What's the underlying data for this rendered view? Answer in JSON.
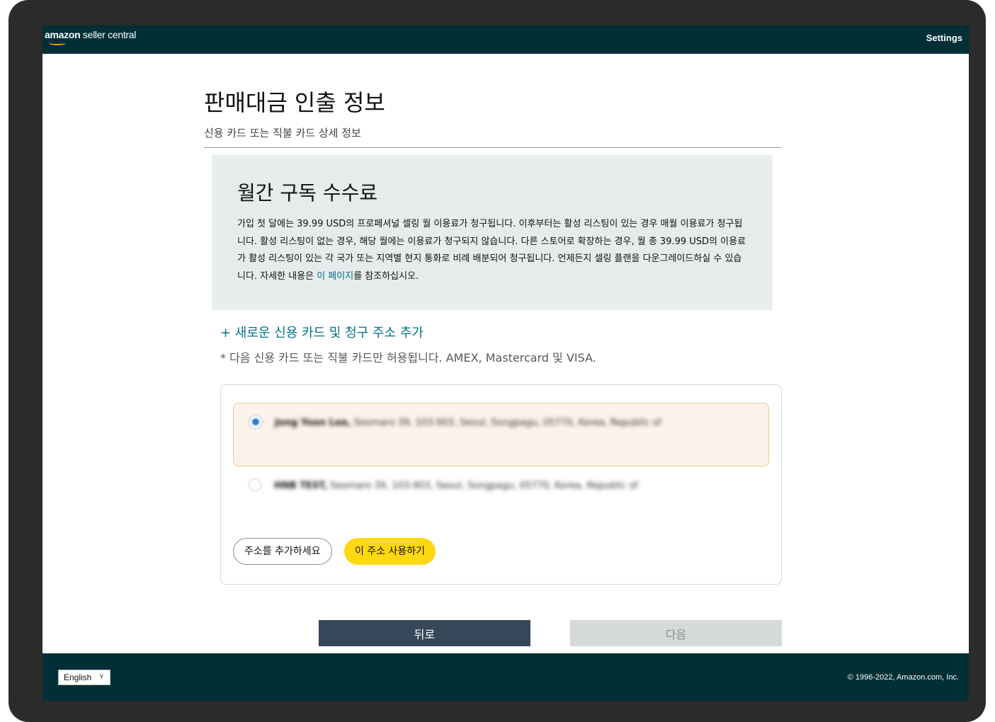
{
  "header": {
    "logo_brand": "amazon",
    "logo_product": "seller central",
    "settings_label": "Settings"
  },
  "page": {
    "title": "판매대금 인출 정보",
    "subtitle": "신용 카드 또는 직불 카드 상세 정보"
  },
  "fee_box": {
    "title": "월간 구독 수수료",
    "body_before_link": "가입 첫 달에는 39.99 USD의 프로페셔널 셀링 월 이용료가 청구됩니다. 이후부터는 활성 리스팅이 있는 경우 매월 이용료가 청구됩니다. 활성 리스팅이 없는 경우, 해당 월에는 이용료가 청구되지 않습니다. 다른 스토어로 확장하는 경우, 월 총 39.99 USD의 이용료가 활성 리스팅이 있는 각 국가 또는 지역별 현지 통화로 비례 배분되어 청구됩니다. 언제든지 셀링 플랜을 다운그레이드하실 수 있습니다. 자세한 내용은 ",
    "link_text": "이 페이지",
    "body_after_link": "를 참조하십시오."
  },
  "card": {
    "add_link": "+ 새로운 신용 카드 및 청구 주소 추가",
    "note": "* 다음 신용 카드 또는 직불 카드만 허용됩니다. AMEX, Mastercard 및 VISA."
  },
  "addresses": [
    {
      "name": "Jong Yoon Lee,",
      "detail": "Seomaro 39, 103-903, Seoul, Songpagu, 05770, Korea, Republic of",
      "selected": true
    },
    {
      "name": "HNB TEST,",
      "detail": "Seomaro 39, 103-903, Seoul, Songpagu, 05770, Korea, Republic of",
      "selected": false
    }
  ],
  "address_actions": {
    "add_address": "주소를 추가하세요",
    "use_address": "이 주소 사용하기"
  },
  "navigation": {
    "back": "뒤로",
    "next": "다음"
  },
  "footer": {
    "language": "English",
    "copyright": "© 1996-2022, Amazon.com, Inc."
  },
  "colors": {
    "header_bg": "#002f36",
    "link": "#007185",
    "primary_button": "#ffd814",
    "back_button": "#37475a",
    "selected_option_bg": "#fdf3ea"
  }
}
